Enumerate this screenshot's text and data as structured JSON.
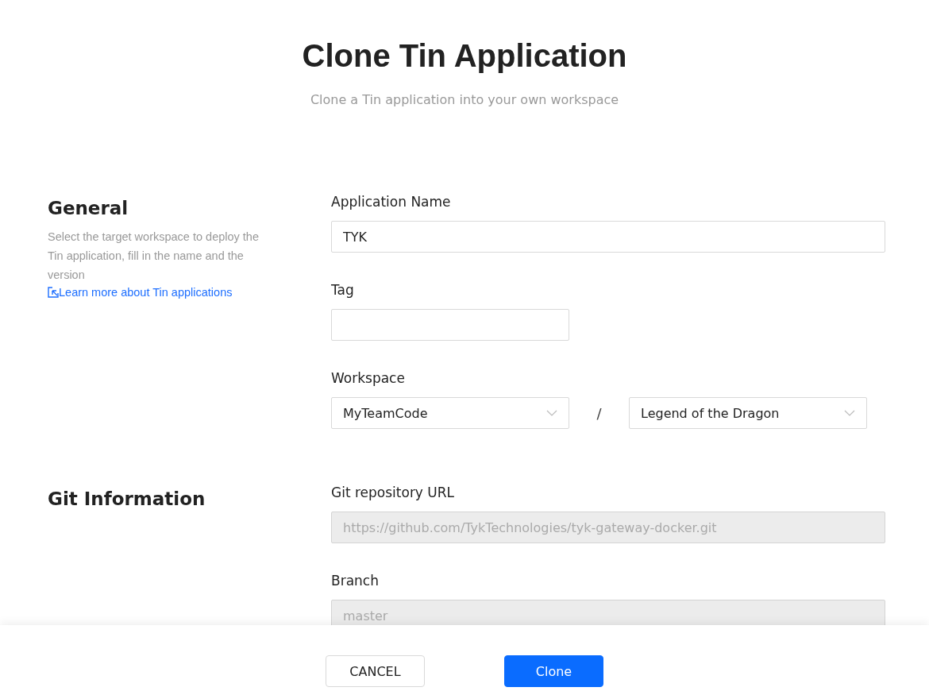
{
  "header": {
    "title": "Clone Tin Application",
    "subtitle": "Clone a Tin application into your own workspace"
  },
  "sections": [
    {
      "title": "General",
      "description": "Select the target workspace to deploy the Tin application, fill in the name and the version",
      "link": "Learn more about Tin applications",
      "fields": [
        {
          "kind": "text",
          "label": "Application Name",
          "value": "TYK",
          "disabled": false
        },
        {
          "kind": "short_text",
          "label": "Tag",
          "disabled": false
        },
        {
          "kind": "select_pair",
          "label": "Workspace",
          "selects": [
            "MyTeamCode",
            "Legend of the Dragon"
          ],
          "separator": "/"
        }
      ]
    },
    {
      "title": "Git Information",
      "fields": [
        {
          "kind": "text",
          "label": "Git repository URL",
          "value": "https://github.com/TykTechnologies/tyk-gateway-docker.git",
          "disabled": true
        },
        {
          "kind": "text",
          "label": "Branch",
          "value": "master",
          "disabled": true
        }
      ]
    }
  ],
  "buttons": [
    {
      "label": "CANCEL",
      "kind": "secondary"
    },
    {
      "label": "Clone",
      "kind": "primary"
    }
  ]
}
